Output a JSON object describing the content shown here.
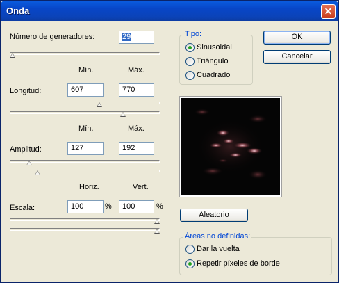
{
  "window": {
    "title": "Onda",
    "close_glyph": "✕"
  },
  "generators": {
    "label": "Número de generadores:",
    "value": "29",
    "slider_fraction": 0.02
  },
  "wavelength": {
    "label": "Longitud:",
    "min_header": "Mín.",
    "max_header": "Máx.",
    "min_value": "607",
    "max_value": "770",
    "min_fraction": 0.61,
    "max_fraction": 0.77
  },
  "amplitude": {
    "label": "Amplitud:",
    "min_header": "Mín.",
    "max_header": "Máx.",
    "min_value": "127",
    "max_value": "192",
    "min_fraction": 0.13,
    "max_fraction": 0.19
  },
  "scale": {
    "label": "Escala:",
    "horiz_header": "Horiz.",
    "vert_header": "Vert.",
    "horiz_value": "100",
    "vert_value": "100",
    "unit": "%",
    "horiz_fraction": 1.0,
    "vert_fraction": 1.0
  },
  "type": {
    "title": "Tipo:",
    "options": [
      "Sinusoidal",
      "Triángulo",
      "Cuadrado"
    ],
    "selected": "Sinusoidal"
  },
  "buttons": {
    "ok": "OK",
    "cancel": "Cancelar",
    "randomize": "Aleatorio"
  },
  "undefined_areas": {
    "title": "Áreas no definidas:",
    "options": [
      "Dar la vuelta",
      "Repetir píxeles de borde"
    ],
    "selected": "Repetir píxeles de borde"
  },
  "colors": {
    "title_bar": "#0a5de0",
    "dialog_bg": "#ece9d8",
    "group_title": "#0046d5"
  }
}
